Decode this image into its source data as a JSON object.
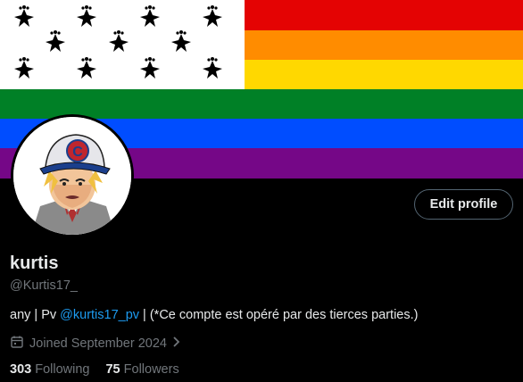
{
  "banner": {
    "rainbow_colors": [
      "#e40303",
      "#ff8c00",
      "#ffd800",
      "#008026",
      "#004dff",
      "#750787"
    ],
    "flag_icon": "hermine-flag"
  },
  "profile": {
    "display_name": "kurtis",
    "handle": "@Kurtis17_",
    "avatar_icon": "anime-boy-avatar",
    "edit_button_label": "Edit profile",
    "bio": {
      "prefix": "any |  Pv ",
      "mention": "@kurtis17_pv",
      "suffix": " | (*Ce compte est opéré par des tierces parties.)"
    },
    "joined": "Joined September 2024",
    "following_count": "303",
    "following_label": "Following",
    "followers_count": "75",
    "followers_label": "Followers"
  },
  "colors": {
    "accent": "#1d9bf0",
    "muted": "#71767b",
    "text": "#e7e9ea"
  }
}
